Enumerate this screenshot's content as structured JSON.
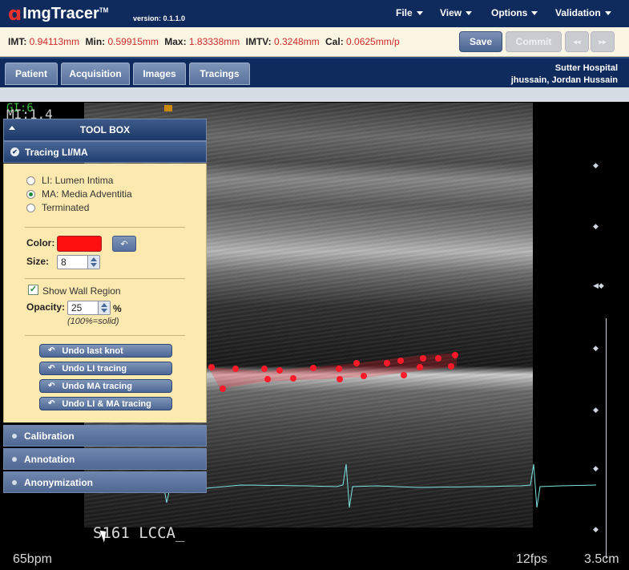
{
  "app": {
    "logo_mark": "ɑ",
    "name": "ImgTracer",
    "tm": "TM",
    "version": "version: 0.1.1.0"
  },
  "menu": [
    {
      "label": "File"
    },
    {
      "label": "View"
    },
    {
      "label": "Options"
    },
    {
      "label": "Validation"
    }
  ],
  "metrics": {
    "imt_label": "IMT:",
    "imt": "0.94113mm",
    "min_label": "Min:",
    "min": "0.59915mm",
    "max_label": "Max:",
    "max": "1.83338mm",
    "imtv_label": "IMTV:",
    "imtv": "0.3248mm",
    "cal_label": "Cal:",
    "cal": "0.0625mm/p"
  },
  "actions": {
    "save": "Save",
    "commit": "Commit",
    "prev": "◂◂",
    "next": "▸▸"
  },
  "tabs": [
    {
      "label": "Patient"
    },
    {
      "label": "Acquisition"
    },
    {
      "label": "Images"
    },
    {
      "label": "Tracings"
    }
  ],
  "site": {
    "hospital": "Sutter Hospital",
    "user": "jhussain, Jordan Hussain"
  },
  "toolbox": {
    "title": "TOOL BOX",
    "active_section": "Tracing LI/MA",
    "radios": [
      {
        "label": "LI: Lumen Intima",
        "selected": false
      },
      {
        "label": "MA: Media Adventitia",
        "selected": true
      },
      {
        "label": "Terminated",
        "selected": false
      }
    ],
    "color_label": "Color:",
    "color_value": "#ff1010",
    "size_label": "Size:",
    "size_value": "8",
    "show_wall_label": "Show Wall Region",
    "show_wall_checked": true,
    "opacity_label": "Opacity:",
    "opacity_value": "25",
    "opacity_unit": "%",
    "opacity_hint": "(100%=solid)",
    "undo_buttons": [
      {
        "label": "Undo last knot"
      },
      {
        "label": "Undo LI tracing"
      },
      {
        "label": "Undo MA tracing"
      },
      {
        "label": "Undo LI & MA tracing"
      }
    ],
    "sections": [
      {
        "label": "Calibration"
      },
      {
        "label": "Annotation"
      },
      {
        "label": "Anonymization"
      }
    ]
  },
  "ultrasound": {
    "top_text_1": "GI:6",
    "top_text_2": "MI:1.4",
    "label": "S161 LCCA_",
    "heart_rate": "65bpm",
    "fps": "12fps",
    "depth": "3.5cm",
    "trace_color": "#ff1a2a",
    "ecg_color": "#7fe3e3"
  }
}
